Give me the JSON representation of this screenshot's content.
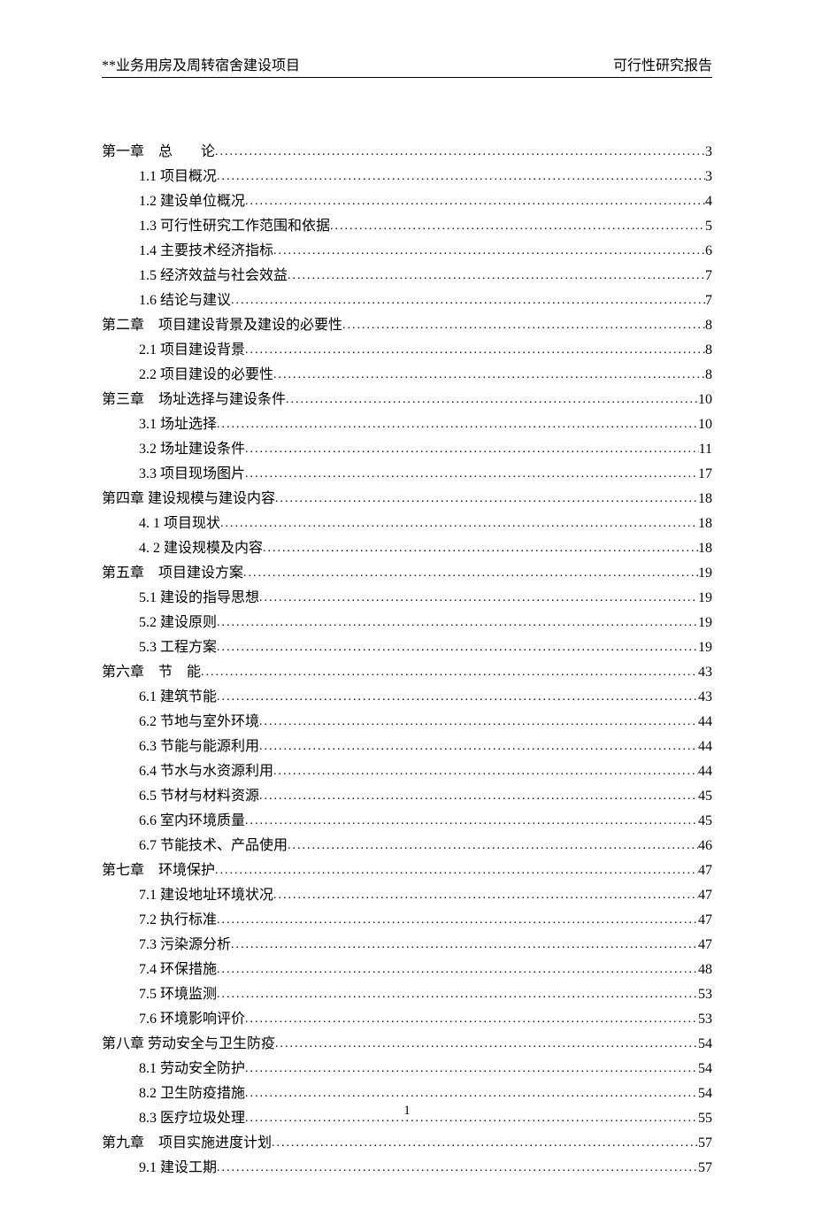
{
  "header": {
    "left": "**业务用房及周转宿舍建设项目",
    "right": "可行性研究报告"
  },
  "page_number": "1",
  "toc": [
    {
      "level": "chapter",
      "title": "第一章　总　　论",
      "page": "3"
    },
    {
      "level": "section",
      "title": "1.1 项目概况",
      "page": "3"
    },
    {
      "level": "section",
      "title": "1.2 建设单位概况",
      "page": "4"
    },
    {
      "level": "section",
      "title": "1.3 可行性研究工作范围和依据",
      "page": "5"
    },
    {
      "level": "section",
      "title": "1.4 主要技术经济指标",
      "page": "6"
    },
    {
      "level": "section",
      "title": "1.5 经济效益与社会效益",
      "page": "7"
    },
    {
      "level": "section",
      "title": "1.6 结论与建议",
      "page": "7"
    },
    {
      "level": "chapter",
      "title": "第二章　项目建设背景及建设的必要性",
      "page": "8"
    },
    {
      "level": "section",
      "title": "2.1 项目建设背景",
      "page": "8"
    },
    {
      "level": "section",
      "title": "2.2 项目建设的必要性",
      "page": "8"
    },
    {
      "level": "chapter",
      "title": "第三章　场址选择与建设条件",
      "page": "10"
    },
    {
      "level": "section",
      "title": "3.1 场址选择",
      "page": "10"
    },
    {
      "level": "section",
      "title": "3.2 场址建设条件",
      "page": "11"
    },
    {
      "level": "section",
      "title": "3.3 项目现场图片",
      "page": "17"
    },
    {
      "level": "chapter",
      "title": "第四章 建设规模与建设内容",
      "page": "18"
    },
    {
      "level": "section",
      "title": "4. 1 项目现状",
      "page": "18"
    },
    {
      "level": "section",
      "title": "4. 2 建设规模及内容",
      "page": "18"
    },
    {
      "level": "chapter",
      "title": "第五章　项目建设方案",
      "page": "19"
    },
    {
      "level": "section",
      "title": "5.1 建设的指导思想",
      "page": "19"
    },
    {
      "level": "section",
      "title": "5.2 建设原则",
      "page": "19"
    },
    {
      "level": "section",
      "title": "5.3 工程方案",
      "page": "19"
    },
    {
      "level": "chapter",
      "title": "第六章　节　能",
      "page": "43"
    },
    {
      "level": "section",
      "title": "6.1 建筑节能",
      "page": "43"
    },
    {
      "level": "section",
      "title": "6.2 节地与室外环境",
      "page": "44"
    },
    {
      "level": "section",
      "title": "6.3 节能与能源利用",
      "page": "44"
    },
    {
      "level": "section",
      "title": "6.4 节水与水资源利用",
      "page": "44"
    },
    {
      "level": "section",
      "title": "6.5 节材与材料资源",
      "page": "45"
    },
    {
      "level": "section",
      "title": "6.6 室内环境质量",
      "page": "45"
    },
    {
      "level": "section",
      "title": "6.7 节能技术、产品使用",
      "page": "46"
    },
    {
      "level": "chapter",
      "title": "第七章　环境保护",
      "page": "47"
    },
    {
      "level": "section",
      "title": "7.1 建设地址环境状况",
      "page": "47"
    },
    {
      "level": "section",
      "title": "7.2 执行标准",
      "page": "47"
    },
    {
      "level": "section",
      "title": "7.3 污染源分析",
      "page": "47"
    },
    {
      "level": "section",
      "title": "7.4 环保措施",
      "page": "48"
    },
    {
      "level": "section",
      "title": "7.5 环境监测",
      "page": "53"
    },
    {
      "level": "section",
      "title": "7.6 环境影响评价",
      "page": "53"
    },
    {
      "level": "chapter",
      "title": "第八章 劳动安全与卫生防疫",
      "page": "54"
    },
    {
      "level": "section",
      "title": "8.1 劳动安全防护",
      "page": "54"
    },
    {
      "level": "section",
      "title": "8.2 卫生防疫措施",
      "page": "54"
    },
    {
      "level": "section",
      "title": "8.3 医疗垃圾处理",
      "page": "55"
    },
    {
      "level": "chapter",
      "title": "第九章　项目实施进度计划",
      "page": "57"
    },
    {
      "level": "section",
      "title": "9.1 建设工期",
      "page": "57"
    }
  ]
}
